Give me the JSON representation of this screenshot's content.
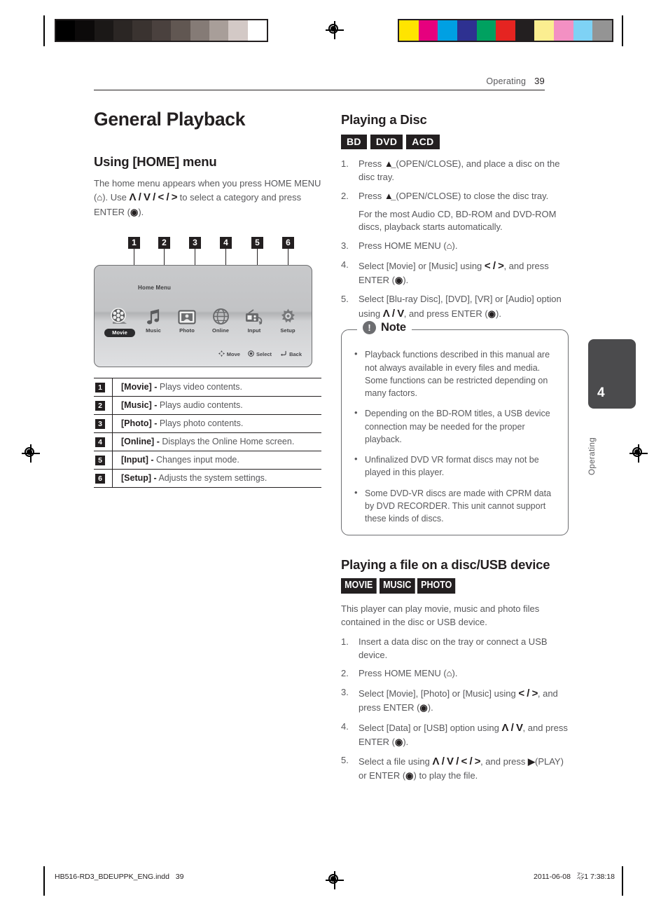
{
  "header": {
    "section": "Operating",
    "page_number": "39"
  },
  "left_column": {
    "title": "General Playback",
    "home_section": {
      "heading": "Using [HOME] menu",
      "paragraph_part1": "The home menu appears when you press HOME MENU (",
      "home_icon": "home-icon",
      "paragraph_part2": "). Use ",
      "nav_keys": "Λ / V / < / >",
      "paragraph_part3": " to select a category and press ENTER (",
      "enter_icon": "enter-icon",
      "paragraph_part4": ")."
    },
    "figure": {
      "screen_title": "Home Menu",
      "callouts": [
        "1",
        "2",
        "3",
        "4",
        "5",
        "6"
      ],
      "menu_items": [
        {
          "label": "Movie",
          "icon": "film-reel-icon",
          "selected": true
        },
        {
          "label": "Music",
          "icon": "music-note-icon",
          "selected": false
        },
        {
          "label": "Photo",
          "icon": "photo-frame-icon",
          "selected": false
        },
        {
          "label": "Online",
          "icon": "globe-icon",
          "selected": false
        },
        {
          "label": "Input",
          "icon": "input-radio-icon",
          "selected": false
        },
        {
          "label": "Setup",
          "icon": "gear-icon",
          "selected": false
        }
      ],
      "hints": [
        {
          "icon": "dpad-icon",
          "label": "Move"
        },
        {
          "icon": "enter-icon",
          "label": "Select"
        },
        {
          "icon": "return-icon",
          "label": "Back"
        }
      ]
    },
    "legend": [
      {
        "num": "1",
        "term": "[Movie] -",
        "desc": " Plays video contents."
      },
      {
        "num": "2",
        "term": "[Music] -",
        "desc": " Plays audio contents."
      },
      {
        "num": "3",
        "term": "[Photo] -",
        "desc": " Plays photo contents."
      },
      {
        "num": "4",
        "term": "[Online] -",
        "desc": " Displays the Online Home screen."
      },
      {
        "num": "5",
        "term": "[Input] -",
        "desc": " Changes input mode."
      },
      {
        "num": "6",
        "term": "[Setup] -",
        "desc": " Adjusts the system settings."
      }
    ]
  },
  "right_column": {
    "disc_section": {
      "heading": "Playing a Disc",
      "badges": [
        "BD",
        "DVD",
        "ACD"
      ],
      "steps": [
        {
          "pre": "Press ",
          "icon": "eject-icon",
          "post": " (OPEN/CLOSE), and place a disc on the disc tray.",
          "extra": ""
        },
        {
          "pre": "Press ",
          "icon": "eject-icon",
          "post": " (OPEN/CLOSE) to close the disc tray.",
          "extra": "For the most Audio CD, BD-ROM and DVD-ROM discs, playback starts automatically."
        },
        {
          "pre": "Press HOME MENU (",
          "icon": "home-icon",
          "post": ").",
          "extra": ""
        },
        {
          "pre": "Select [Movie] or [Music] using ",
          "keys": "< / >",
          "post": ", and press ENTER (",
          "icon2": "enter-icon",
          "post2": ")."
        },
        {
          "pre": "Select [Blu-ray Disc], [DVD], [VR] or [Audio] option using ",
          "keys": "Λ / V",
          "post": ", and press ENTER (",
          "icon2": "enter-icon",
          "post2": ")."
        }
      ]
    },
    "note": {
      "icon": "exclamation-icon",
      "title": "Note",
      "items": [
        "Playback functions described in this manual are not always available in every files and media. Some functions can be restricted depending on many factors.",
        "Depending on the BD-ROM titles, a USB device connection may be needed for the proper playback.",
        "Unfinalized DVD VR format discs may not be played in this player.",
        "Some DVD-VR discs are made with CPRM data by DVD RECORDER. This unit cannot support these kinds of discs."
      ]
    },
    "file_section": {
      "heading": "Playing a file on a disc/USB device",
      "badges": [
        "MOVIE",
        "MUSIC",
        "PHOTO"
      ],
      "intro": "This player can play movie, music and photo files contained in the disc or USB device.",
      "steps": [
        {
          "pre": "Insert a data disc on the tray or connect a USB device.",
          "post": ""
        },
        {
          "pre": "Press HOME MENU (",
          "icon": "home-icon",
          "post": ")."
        },
        {
          "pre": "Select [Movie], [Photo] or [Music] using ",
          "keys": "< / >",
          "post": ", and press ENTER (",
          "icon2": "enter-icon",
          "post2": ")."
        },
        {
          "pre": "Select [Data] or [USB] option using ",
          "keys": "Λ / V",
          "post": ", and press ENTER (",
          "icon2": "enter-icon",
          "post2": ")."
        },
        {
          "pre": "Select a file using ",
          "keys": "Λ / V / < / >",
          "post": ", and press ",
          "play_icon": "play-icon",
          "post2": "(PLAY) or ENTER (",
          "icon2": "enter-icon",
          "post3": ") to play the file."
        }
      ]
    }
  },
  "chapter_tab": {
    "number": "4",
    "label": "Operating"
  },
  "footer": {
    "filename": "HB516-RD3_BDEUPPK_ENG.indd   39",
    "timestamp": "2011-06-08   ㌂1 7:38:18"
  },
  "print_marks": {
    "grayscale_swatches": [
      "#000000",
      "#0c0a0a",
      "#1b1817",
      "#2b2624",
      "#3a3330",
      "#4a413e",
      "#615752",
      "#857b76",
      "#a89e99",
      "#d3c9c6",
      "#ffffff"
    ],
    "color_swatches": [
      "#ffe400",
      "#e6007e",
      "#00a0e3",
      "#2e3191",
      "#00a160",
      "#e52421",
      "#231f20",
      "#fbee90",
      "#f390c3",
      "#7ed2f5",
      "#949494"
    ]
  }
}
